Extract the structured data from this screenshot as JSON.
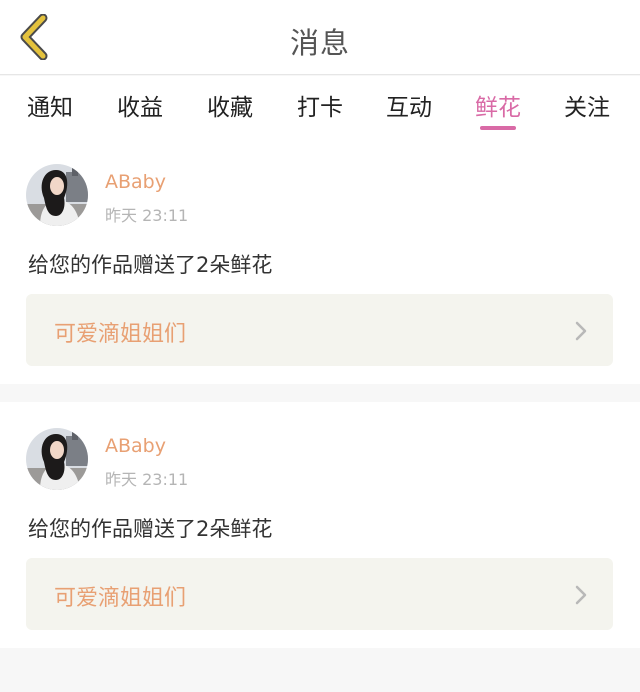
{
  "header": {
    "title": "消息",
    "back_icon": "chevron-left-icon",
    "accent_color": "#e4c23d"
  },
  "tabs": [
    {
      "label": "通知",
      "active": false
    },
    {
      "label": "收益",
      "active": false
    },
    {
      "label": "收藏",
      "active": false
    },
    {
      "label": "打卡",
      "active": false
    },
    {
      "label": "互动",
      "active": false
    },
    {
      "label": "鲜花",
      "active": true
    },
    {
      "label": "关注",
      "active": false
    }
  ],
  "active_tab_color": "#d96aa6",
  "messages": [
    {
      "username": "ABaby",
      "time": "昨天 23:11",
      "text": "给您的作品赠送了2朵鲜花",
      "work_title": "可爱滴姐姐们",
      "link_icon": "chevron-right-icon"
    },
    {
      "username": "ABaby",
      "time": "昨天 23:11",
      "text": "给您的作品赠送了2朵鲜花",
      "work_title": "可爱滴姐姐们",
      "link_icon": "chevron-right-icon"
    }
  ]
}
